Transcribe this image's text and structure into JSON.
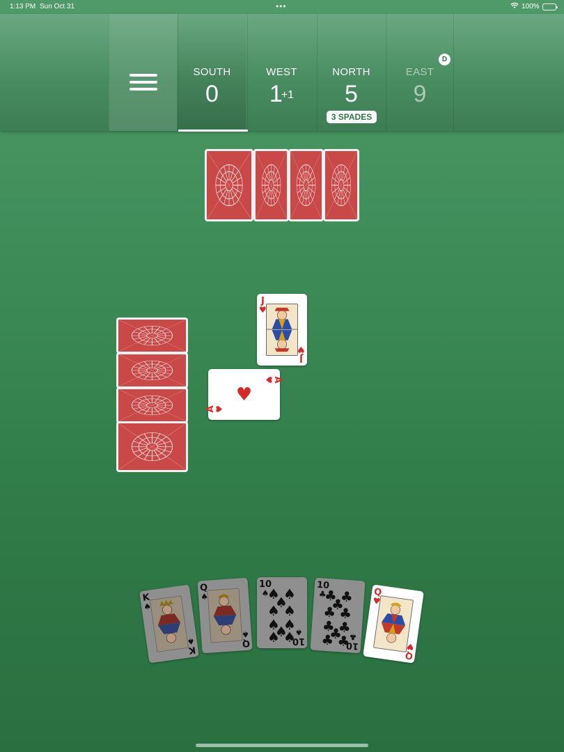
{
  "status_bar": {
    "time": "1:13 PM",
    "date": "Sun Oct 31",
    "dots": "•••",
    "battery": "100%"
  },
  "header": {
    "players": [
      {
        "name": "SOUTH",
        "score": "0",
        "score_sup": ""
      },
      {
        "name": "WEST",
        "score": "1",
        "score_sup": "+1"
      },
      {
        "name": "NORTH",
        "score": "5",
        "score_sup": ""
      },
      {
        "name": "EAST",
        "score": "9",
        "score_sup": ""
      }
    ],
    "north_bid": "3 SPADES",
    "dealer_badge": "D",
    "active_player": "SOUTH",
    "dimmed_player": "EAST"
  },
  "table": {
    "north_cards_remaining": 4,
    "west_cards_remaining": 4,
    "trick": [
      {
        "player": "NORTH",
        "rank": "J",
        "suit": "♥"
      },
      {
        "player": "WEST",
        "rank": "A",
        "suit": "♥"
      }
    ]
  },
  "hand": [
    {
      "rank": "K",
      "suit": "♠",
      "playable": false
    },
    {
      "rank": "Q",
      "suit": "♠",
      "playable": false
    },
    {
      "rank": "10",
      "suit": "♠",
      "playable": false
    },
    {
      "rank": "10",
      "suit": "♣",
      "playable": false
    },
    {
      "rank": "Q",
      "suit": "♥",
      "playable": true
    }
  ],
  "colors": {
    "felt": "#3d8c58",
    "card_back": "#c94848",
    "red_suit": "#d42a2a",
    "badge_text": "#2d7a45"
  }
}
